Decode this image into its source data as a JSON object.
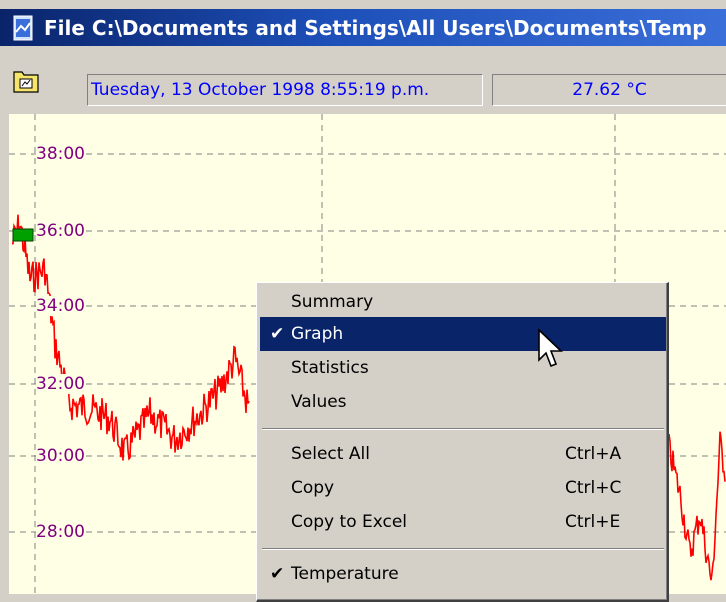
{
  "window": {
    "title": "File C:\\Documents and Settings\\All Users\\Documents\\Temp"
  },
  "toolbar": {
    "datetime": "Tuesday, 13 October 1998 8:55:19 p.m.",
    "temperature": "27.62 °C"
  },
  "graph": {
    "y_ticks": [
      "38:00",
      "36:00",
      "34:00",
      "32:00",
      "30:00",
      "28:00"
    ],
    "line_color": "#ff0000",
    "grid_color": "#808080",
    "marker_color": "#00a000"
  },
  "context_menu": {
    "items": [
      {
        "label": "Summary",
        "shortcut": "",
        "checked": false,
        "selected": false
      },
      {
        "label": "Graph",
        "shortcut": "",
        "checked": true,
        "selected": true
      },
      {
        "label": "Statistics",
        "shortcut": "",
        "checked": false,
        "selected": false
      },
      {
        "label": "Values",
        "shortcut": "",
        "checked": false,
        "selected": false
      },
      {
        "label": "Select All",
        "shortcut": "Ctrl+A",
        "checked": false,
        "selected": false
      },
      {
        "label": "Copy",
        "shortcut": "Ctrl+C",
        "checked": false,
        "selected": false
      },
      {
        "label": "Copy to Excel",
        "shortcut": "Ctrl+E",
        "checked": false,
        "selected": false
      },
      {
        "label": "Temperature",
        "shortcut": "",
        "checked": true,
        "selected": false
      }
    ],
    "check_glyph": "✔"
  }
}
